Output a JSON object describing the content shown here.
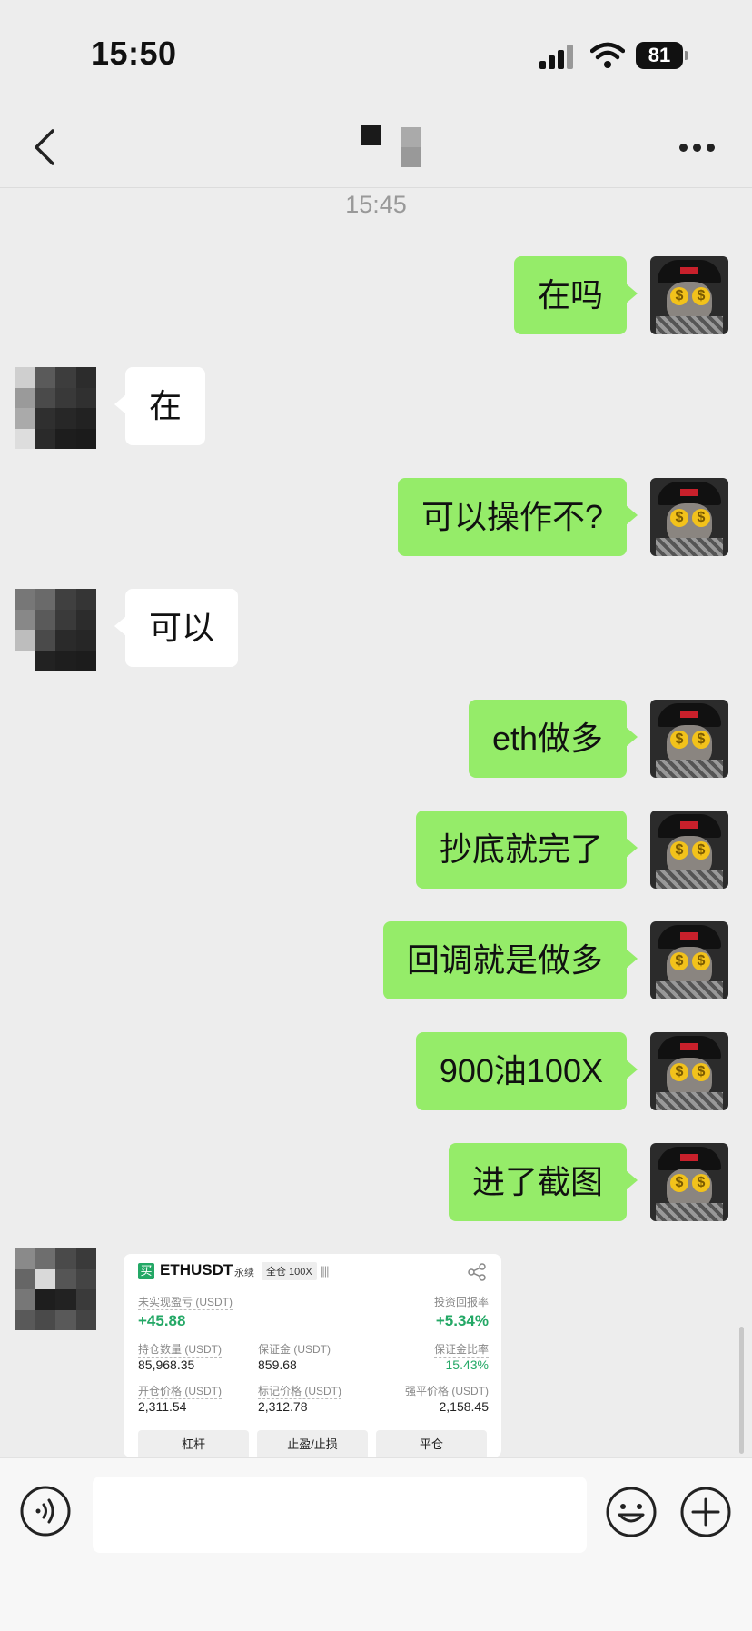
{
  "status_bar": {
    "time": "15:50",
    "battery": "81"
  },
  "header": {
    "title": ""
  },
  "timestamp": "15:45",
  "messages": [
    {
      "from": "me",
      "text": "在吗"
    },
    {
      "from": "them",
      "text": "在"
    },
    {
      "from": "me",
      "text": "可以操作不?"
    },
    {
      "from": "them",
      "text": "可以"
    },
    {
      "from": "me",
      "text": "eth做多"
    },
    {
      "from": "me",
      "text": "抄底就完了"
    },
    {
      "from": "me",
      "text": "回调就是做多"
    },
    {
      "from": "me",
      "text": "900油100X"
    },
    {
      "from": "me",
      "text": "进了截图"
    }
  ],
  "position_card": {
    "side_badge": "买",
    "symbol": "ETHUSDT",
    "contract_type": "永续",
    "margin_mode": "全仓 100X",
    "bars": "||||",
    "unrealized_pnl_label": "未实现盈亏 (USDT)",
    "unrealized_pnl": "+45.88",
    "roi_label": "投资回报率",
    "roi": "+5.34%",
    "size_label": "持仓数量 (USDT)",
    "size": "85,968.35",
    "margin_label": "保证金 (USDT)",
    "margin": "859.68",
    "margin_ratio_label": "保证金比率",
    "margin_ratio": "15.43%",
    "entry_price_label": "开仓价格 (USDT)",
    "entry_price": "2,311.54",
    "mark_price_label": "标记价格 (USDT)",
    "mark_price": "2,312.78",
    "liq_price_label": "强平价格 (USDT)",
    "liq_price": "2,158.45",
    "buttons": [
      "杠杆",
      "止盈/止损",
      "平仓"
    ]
  },
  "input": {
    "placeholder": ""
  },
  "colors": {
    "my_bubble": "#95ec69",
    "their_bubble": "#ffffff",
    "background": "#ededed",
    "profit_green": "#24a866"
  }
}
